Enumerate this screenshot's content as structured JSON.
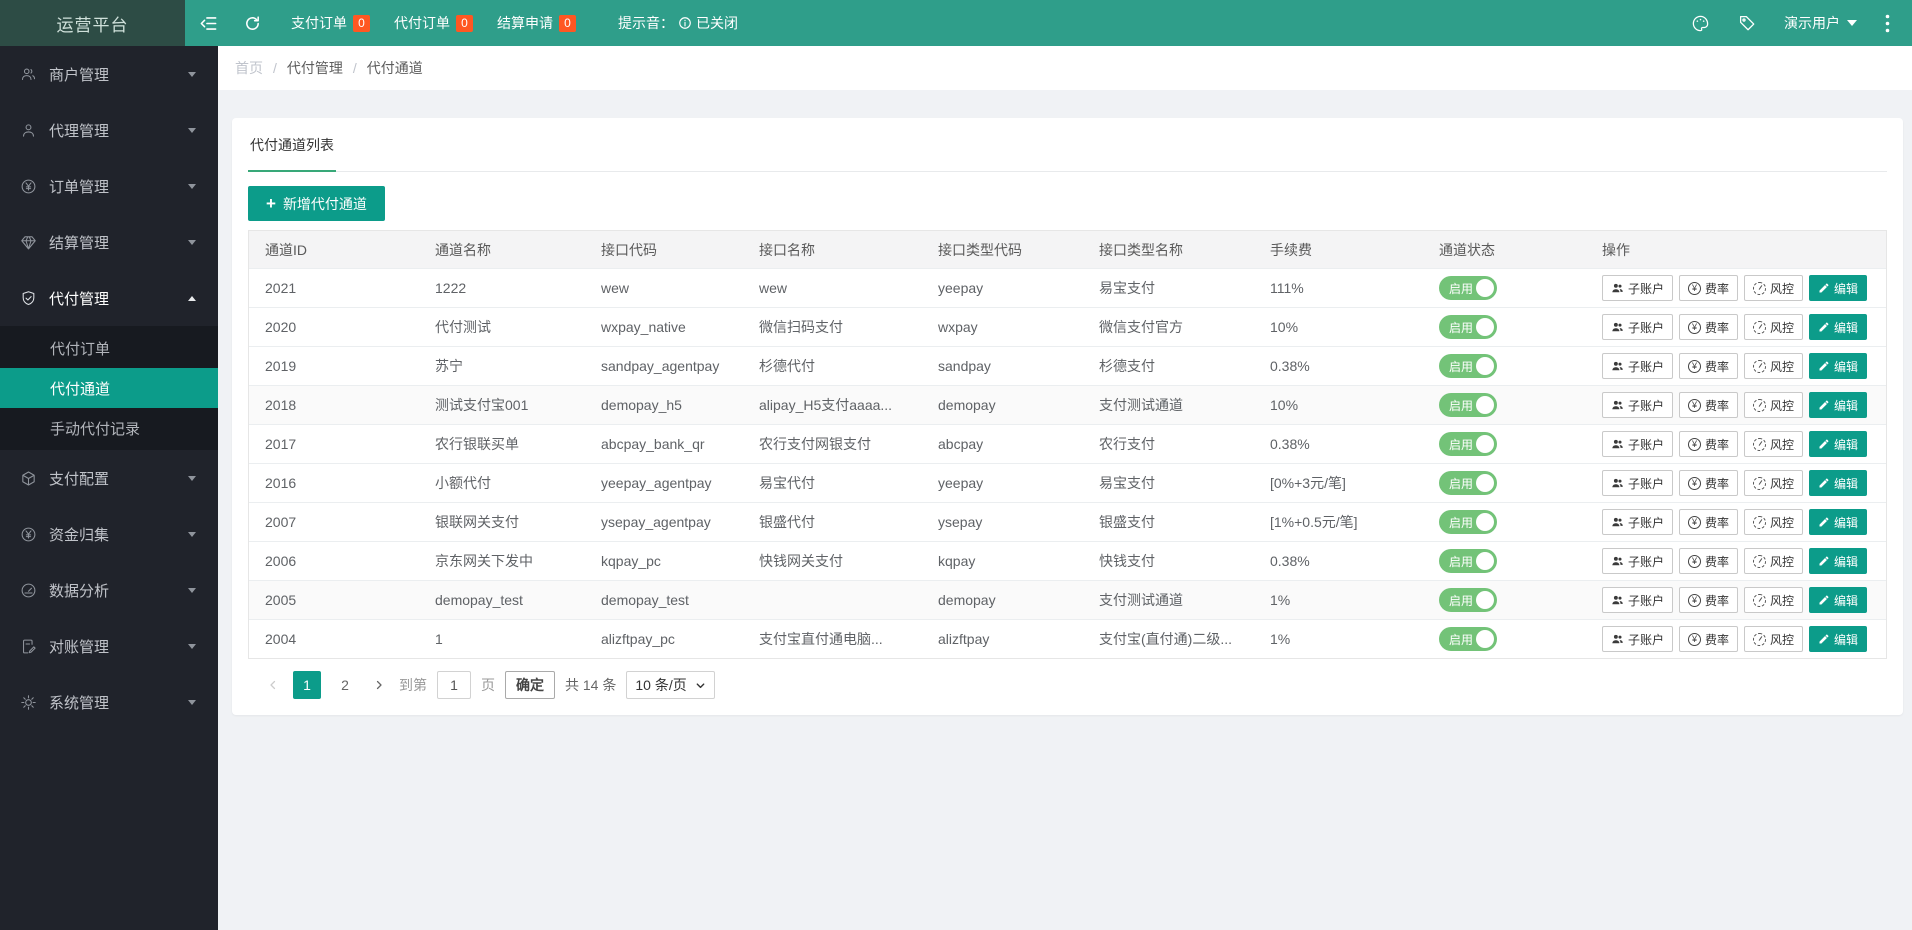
{
  "app": {
    "logo": "运营平台"
  },
  "icons": {
    "plus": "+"
  },
  "colors": {
    "topbar": "#2f9e8a",
    "logo_bg": "#2d4c45",
    "sidebar_bg": "#20232b",
    "submenu_bg": "#171a20",
    "primary": "#0c9c8a",
    "tab_underline": "#38a878",
    "toggle_on": "#73c378",
    "badge": "#ff5722",
    "page_bg": "#f0f2f5"
  },
  "topbar": {
    "tabs": [
      {
        "label": "支付订单",
        "badge": "0"
      },
      {
        "label": "代付订单",
        "badge": "0"
      },
      {
        "label": "结算申请",
        "badge": "0"
      }
    ],
    "sound_label": "提示音：",
    "sound_status": "已关闭",
    "user": "演示用户"
  },
  "sidebar": {
    "items": [
      {
        "label": "商户管理"
      },
      {
        "label": "代理管理"
      },
      {
        "label": "订单管理"
      },
      {
        "label": "结算管理"
      },
      {
        "label": "代付管理",
        "expanded": true,
        "children": [
          "代付订单",
          "代付通道",
          "手动代付记录"
        ],
        "active_child": "代付通道"
      },
      {
        "label": "支付配置"
      },
      {
        "label": "资金归集"
      },
      {
        "label": "数据分析"
      },
      {
        "label": "对账管理"
      },
      {
        "label": "系统管理"
      }
    ]
  },
  "breadcrumb": {
    "items": [
      "首页",
      "代付管理",
      "代付通道"
    ],
    "separator": "/"
  },
  "main": {
    "tab_title": "代付通道列表",
    "add_button_label": "新增代付通道",
    "table": {
      "headers": [
        "通道ID",
        "通道名称",
        "接口代码",
        "接口名称",
        "接口类型代码",
        "接口类型名称",
        "手续费",
        "通道状态",
        "操作"
      ],
      "status_on_label": "启用",
      "action_labels": {
        "subaccount": "子账户",
        "rate": "费率",
        "risk": "风控",
        "edit": "编辑"
      },
      "rows": [
        {
          "id": "2021",
          "name": "1222",
          "api_code": "wew",
          "api_name": "wew",
          "type_code": "yeepay",
          "type_name": "易宝支付",
          "fee": "111%"
        },
        {
          "id": "2020",
          "name": "代付测试",
          "api_code": "wxpay_native",
          "api_name": "微信扫码支付",
          "type_code": "wxpay",
          "type_name": "微信支付官方",
          "fee": "10%"
        },
        {
          "id": "2019",
          "name": "苏宁",
          "api_code": "sandpay_agentpay",
          "api_name": "杉德代付",
          "type_code": "sandpay",
          "type_name": "杉德支付",
          "fee": "0.38%"
        },
        {
          "id": "2018",
          "name": "测试支付宝001",
          "api_code": "demopay_h5",
          "api_name": "alipay_H5支付aaaa...",
          "type_code": "demopay",
          "type_name": "支付测试通道",
          "fee": "10%"
        },
        {
          "id": "2017",
          "name": "农行银联买单",
          "api_code": "abcpay_bank_qr",
          "api_name": "农行支付网银支付",
          "type_code": "abcpay",
          "type_name": "农行支付",
          "fee": "0.38%"
        },
        {
          "id": "2016",
          "name": "小额代付",
          "api_code": "yeepay_agentpay",
          "api_name": "易宝代付",
          "type_code": "yeepay",
          "type_name": "易宝支付",
          "fee": "[0%+3元/笔]"
        },
        {
          "id": "2007",
          "name": "银联网关支付",
          "api_code": "ysepay_agentpay",
          "api_name": "银盛代付",
          "type_code": "ysepay",
          "type_name": "银盛支付",
          "fee": "[1%+0.5元/笔]"
        },
        {
          "id": "2006",
          "name": "京东网关下发中",
          "api_code": "kqpay_pc",
          "api_name": "快钱网关支付",
          "type_code": "kqpay",
          "type_name": "快钱支付",
          "fee": "0.38%"
        },
        {
          "id": "2005",
          "name": "demopay_test",
          "api_code": "demopay_test",
          "api_name": "",
          "type_code": "demopay",
          "type_name": "支付测试通道",
          "fee": "1%"
        },
        {
          "id": "2004",
          "name": "1",
          "api_code": "alizftpay_pc",
          "api_name": "支付宝直付通电脑...",
          "type_code": "alizftpay",
          "type_name": "支付宝(直付通)二级...",
          "fee": "1%"
        }
      ]
    },
    "pagination": {
      "pages": [
        "1",
        "2"
      ],
      "active_page": "1",
      "goto_label": "到第",
      "goto_value": "1",
      "page_word": "页",
      "confirm_label": "确定",
      "total_label": "共 14 条",
      "per_page": "10 条/页"
    }
  }
}
